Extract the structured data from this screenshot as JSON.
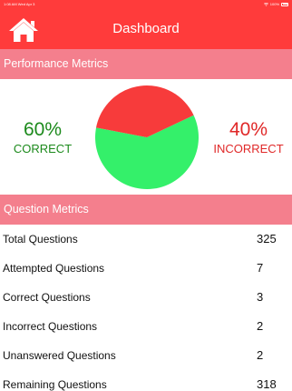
{
  "status_bar": {
    "time_date": "1:08 AM   Wed Apr 3",
    "battery": "100%"
  },
  "header": {
    "title": "Dashboard"
  },
  "performance": {
    "title": "Performance Metrics",
    "correct": {
      "value": "60%",
      "label": "CORRECT",
      "fraction": 0.6,
      "color": "#34f06a"
    },
    "incorrect": {
      "value": "40%",
      "label": "INCORRECT",
      "fraction": 0.4,
      "color": "#f73b3b"
    }
  },
  "question_metrics": {
    "title": "Question Metrics",
    "rows": [
      {
        "label": "Total Questions",
        "value": "325"
      },
      {
        "label": "Attempted Questions",
        "value": "7"
      },
      {
        "label": "Correct Questions",
        "value": "3"
      },
      {
        "label": "Incorrect Questions",
        "value": "2"
      },
      {
        "label": "Unanswered Questions",
        "value": "2"
      },
      {
        "label": "Remaining Questions",
        "value": "318"
      }
    ]
  },
  "colors": {
    "brand_red": "#ff3b3b",
    "section_pink": "#f47f8d",
    "correct_text": "#1c8a1c",
    "incorrect_text": "#e02828"
  }
}
